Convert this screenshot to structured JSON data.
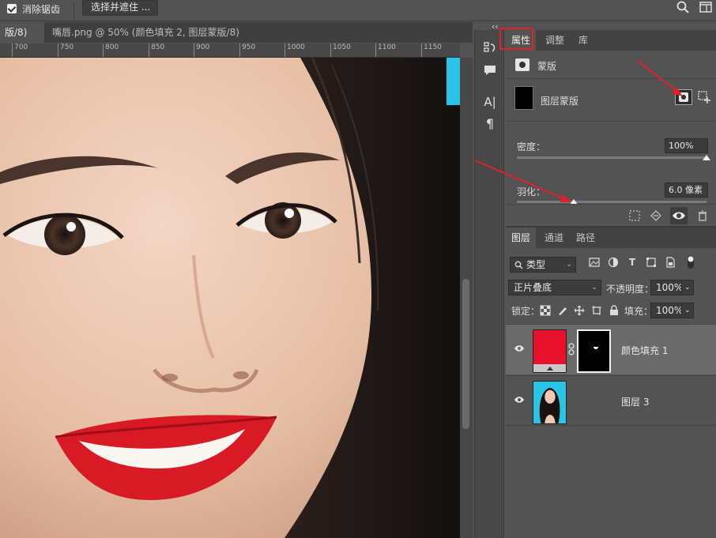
{
  "options": {
    "antialias_label": "消除锯齿",
    "select_mask_button": "选择并遮住 ..."
  },
  "doc_tabs": [
    {
      "label": "版/8) *",
      "close": "×"
    },
    {
      "label": "嘴唇.png @ 50% (颜色填充 2, 图层蒙版/8) *",
      "close": "×"
    }
  ],
  "ruler_ticks": [
    "700",
    "750",
    "800",
    "850",
    "900",
    "950",
    "1000",
    "1050",
    "1100",
    "1150"
  ],
  "toolstrip": {
    "collapse": "‹‹",
    "text_icon": "A|",
    "para_icon": "¶"
  },
  "properties": {
    "tabs": [
      "属性",
      "调整",
      "库"
    ],
    "mask_title": "蒙版",
    "layer_mask_label": "图层蒙版",
    "density_label": "密度：",
    "density_value": "100%",
    "density_level": 1.0,
    "feather_label": "羽化：",
    "feather_value": "6.0 像素",
    "feather_level": 0.3
  },
  "layers": {
    "tabs": [
      "图层",
      "通道",
      "路径"
    ],
    "filter_kind": "类型",
    "blend_mode": "正片叠底",
    "opacity_label": "不透明度：",
    "opacity_value": "100%",
    "lock_label": "锁定：",
    "fill_label": "填充：",
    "fill_value": "100%",
    "items": [
      {
        "name": "颜色填充 1",
        "selected": true
      },
      {
        "name": "图层 3",
        "selected": false
      }
    ]
  },
  "colors": {
    "fill_red": "#e8102a",
    "highlight_red": "#e0202a",
    "photo_bg": "#29c4e6"
  }
}
